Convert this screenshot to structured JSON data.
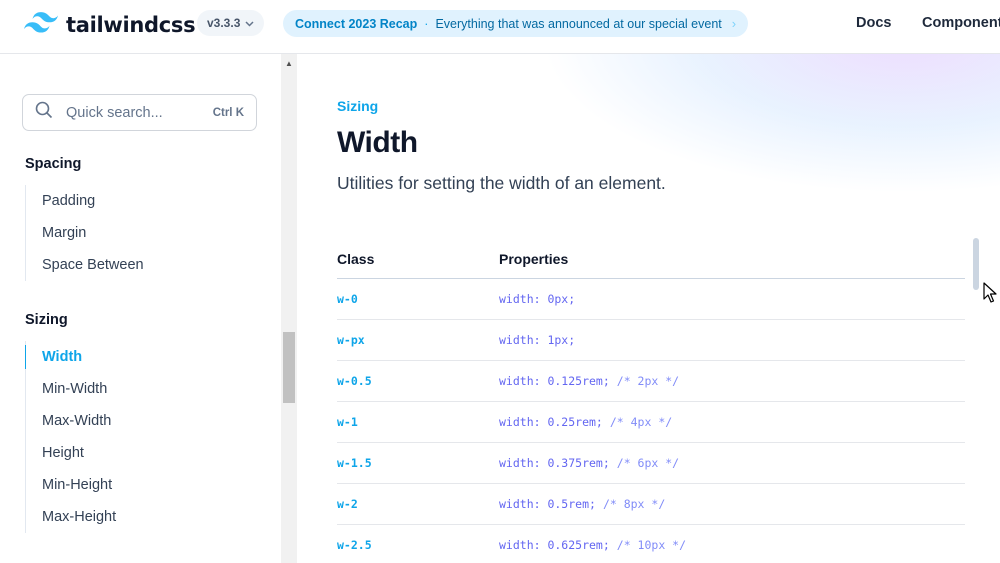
{
  "header": {
    "logo_text": "tailwindcss",
    "version": "v3.3.3",
    "announcement": {
      "title": "Connect 2023 Recap",
      "separator": "·",
      "text": "Everything that was announced at our special event"
    },
    "nav": [
      "Docs",
      "Component"
    ]
  },
  "search": {
    "placeholder": "Quick search...",
    "shortcut": "Ctrl K"
  },
  "sidebar": {
    "sections": [
      {
        "title": "Spacing",
        "items": [
          "Padding",
          "Margin",
          "Space Between"
        ]
      },
      {
        "title": "Sizing",
        "items": [
          "Width",
          "Min-Width",
          "Max-Width",
          "Height",
          "Min-Height",
          "Max-Height"
        ]
      }
    ],
    "active_item": "Width"
  },
  "main": {
    "eyebrow": "Sizing",
    "title": "Width",
    "description": "Utilities for setting the width of an element.",
    "table": {
      "headers": [
        "Class",
        "Properties"
      ],
      "rows": [
        {
          "cls": "w-0",
          "prop": "width: 0px;",
          "comment": ""
        },
        {
          "cls": "w-px",
          "prop": "width: 1px;",
          "comment": ""
        },
        {
          "cls": "w-0.5",
          "prop": "width: 0.125rem;",
          "comment": "/* 2px */"
        },
        {
          "cls": "w-1",
          "prop": "width: 0.25rem;",
          "comment": "/* 4px */"
        },
        {
          "cls": "w-1.5",
          "prop": "width: 0.375rem;",
          "comment": "/* 6px */"
        },
        {
          "cls": "w-2",
          "prop": "width: 0.5rem;",
          "comment": "/* 8px */"
        },
        {
          "cls": "w-2.5",
          "prop": "width: 0.625rem;",
          "comment": "/* 10px */"
        }
      ]
    }
  },
  "colors": {
    "accent": "#0ea5e9",
    "code_property": "#6366f1",
    "heading": "#0f172a"
  }
}
